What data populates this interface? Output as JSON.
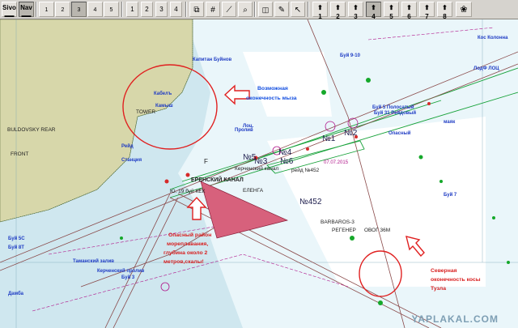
{
  "toolbar": {
    "mode_buttons": [
      {
        "top": "Sivo",
        "bottom": ""
      },
      {
        "top": "Nav",
        "bottom": ""
      }
    ],
    "chart_buttons": [
      "1",
      "2",
      "3",
      "4",
      "5"
    ],
    "page_buttons": [
      "1",
      "2",
      "3",
      "4"
    ],
    "depth_buttons": [
      "1",
      "2",
      "3",
      "4",
      "5",
      "6",
      "7",
      "8"
    ]
  },
  "map": {
    "land_labels": [
      "BULDOVSKY REAR",
      "FRONT",
      "TOWER"
    ],
    "area_labels": [
      "№452",
      "№1",
      "№2",
      "№4",
      "№3",
      "№5",
      "№6"
    ],
    "places": [
      "BARBAROS-3",
      "РЕГЕНЕР",
      "ЕЛЕНГА",
      "F"
    ],
    "pilot_text": "Ю. 19 буй КЕК",
    "small_labels": [
      "Капитан Буйнов",
      "Кабелъ",
      "Камыш",
      "Рейд",
      "Пролив",
      "Кос Колонна",
      "ЛодФ ЛОЦ",
      "ОВОГ 36М",
      "Керченский канал",
      "Буй 5 Полосатый",
      "Буй 31 Рейдовый",
      "Буй 9-10",
      "рейд №452",
      "Таманский залив",
      "Буй 5С",
      "Буй 8Т",
      "Дамба",
      "Буй 3",
      "Керченский пролив",
      "Лоц.",
      "маяк",
      "Опасный",
      "Буй 7",
      "Станция"
    ],
    "date_label": "07.07.2015",
    "canal_label": "ЕРЕНСКИЙ КАНАЛ"
  },
  "annotations": [
    {
      "id": "mouth",
      "lines": [
        "Возможная",
        "оконечность мыза"
      ],
      "color": "#1550e0"
    },
    {
      "id": "danger",
      "lines": [
        "Опасный район",
        "мореплавания,",
        "глубина около 2",
        "метров,скалы!"
      ],
      "color": "#d81f1f"
    },
    {
      "id": "spit",
      "lines": [
        "Северная",
        "оконечность косы",
        "Тузла"
      ],
      "color": "#d81f1f"
    }
  ],
  "watermark": "YAPLAKAL.COM",
  "colors": {
    "sea": "#cfe7ef",
    "deep": "#ffffff",
    "land": "#d7d7aa",
    "danger": "#d7617c",
    "annotation": "#e02020",
    "route": "#8a4a4a"
  }
}
